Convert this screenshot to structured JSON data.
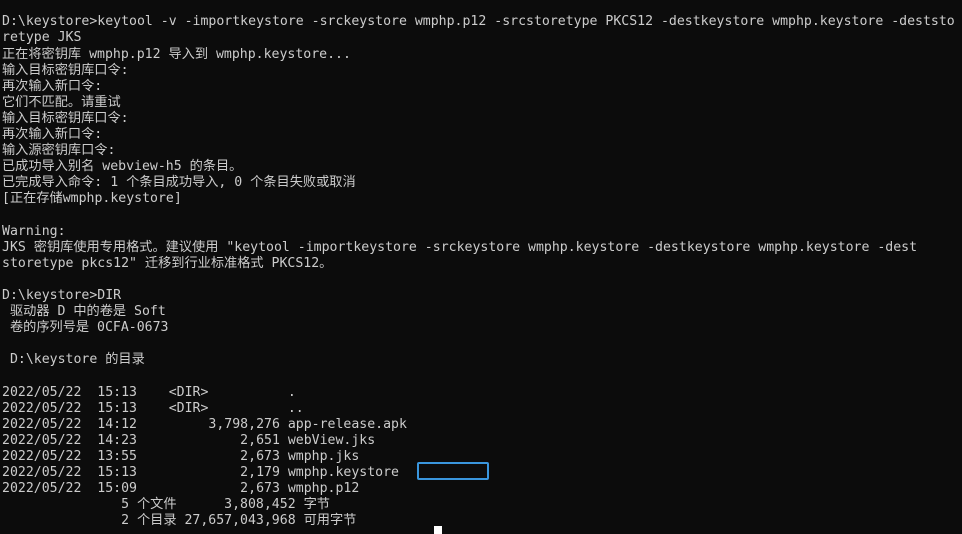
{
  "terminal": {
    "lines": [
      "D:\\keystore>keytool -v -importkeystore -srckeystore wmphp.p12 -srcstoretype PKCS12 -destkeystore wmphp.keystore -deststo",
      "retype JKS",
      "正在将密钥库 wmphp.p12 导入到 wmphp.keystore...",
      "输入目标密钥库口令:",
      "再次输入新口令:",
      "它们不匹配。请重试",
      "输入目标密钥库口令:",
      "再次输入新口令:",
      "输入源密钥库口令:",
      "已成功导入别名 webview-h5 的条目。",
      "已完成导入命令: 1 个条目成功导入, 0 个条目失败或取消",
      "[正在存储wmphp.keystore]",
      "",
      "Warning:",
      "JKS 密钥库使用专用格式。建议使用 \"keytool -importkeystore -srckeystore wmphp.keystore -destkeystore wmphp.keystore -dest",
      "storetype pkcs12\" 迁移到行业标准格式 PKCS12。",
      "",
      "D:\\keystore>DIR",
      " 驱动器 D 中的卷是 Soft",
      " 卷的序列号是 0CFA-0673",
      "",
      " D:\\keystore 的目录",
      "",
      "2022/05/22  15:13    <DIR>          .",
      "2022/05/22  15:13    <DIR>          ..",
      "2022/05/22  14:12         3,798,276 app-release.apk",
      "2022/05/22  14:23             2,651 webView.jks",
      "2022/05/22  13:55             2,673 wmphp.jks",
      "2022/05/22  15:13             2,179 wmphp.keystore",
      "2022/05/22  15:09             2,673 wmphp.p12",
      "               5 个文件      3,808,452 字节",
      "               2 个目录 27,657,043,968 可用字节"
    ]
  }
}
